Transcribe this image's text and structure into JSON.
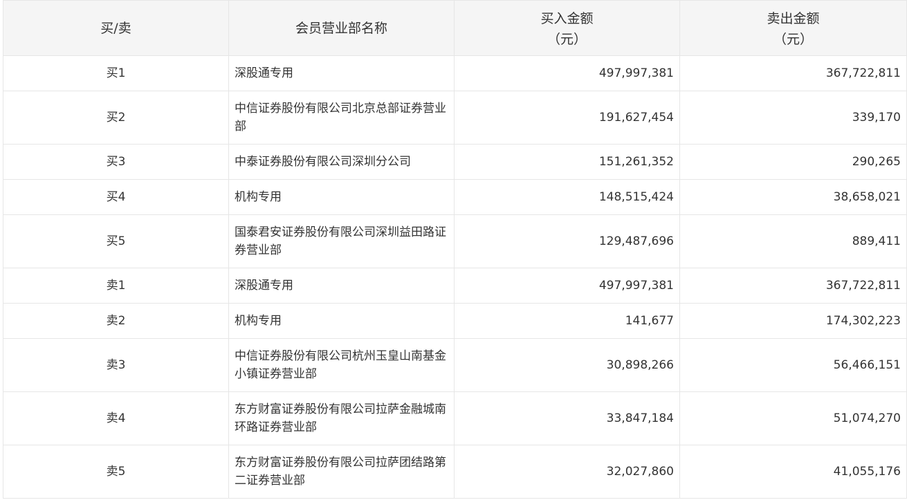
{
  "header": {
    "side": "买/卖",
    "name": "会员营业部名称",
    "buy_line1": "买入金额",
    "buy_line2": "（元）",
    "sell_line1": "卖出金额",
    "sell_line2": "（元）"
  },
  "rows": [
    {
      "side": "买1",
      "name": "深股通专用",
      "buy": "497,997,381",
      "sell": "367,722,811"
    },
    {
      "side": "买2",
      "name": "中信证券股份有限公司北京总部证券营业部",
      "buy": "191,627,454",
      "sell": "339,170"
    },
    {
      "side": "买3",
      "name": "中泰证券股份有限公司深圳分公司",
      "buy": "151,261,352",
      "sell": "290,265"
    },
    {
      "side": "买4",
      "name": "机构专用",
      "buy": "148,515,424",
      "sell": "38,658,021"
    },
    {
      "side": "买5",
      "name": "国泰君安证券股份有限公司深圳益田路证券营业部",
      "buy": "129,487,696",
      "sell": "889,411"
    },
    {
      "side": "卖1",
      "name": "深股通专用",
      "buy": "497,997,381",
      "sell": "367,722,811"
    },
    {
      "side": "卖2",
      "name": "机构专用",
      "buy": "141,677",
      "sell": "174,302,223"
    },
    {
      "side": "卖3",
      "name": "中信证券股份有限公司杭州玉皇山南基金小镇证券营业部",
      "buy": "30,898,266",
      "sell": "56,466,151"
    },
    {
      "side": "卖4",
      "name": "东方财富证券股份有限公司拉萨金融城南环路证券营业部",
      "buy": "33,847,184",
      "sell": "51,074,270"
    },
    {
      "side": "卖5",
      "name": "东方财富证券股份有限公司拉萨团结路第二证券营业部",
      "buy": "32,027,860",
      "sell": "41,055,176"
    }
  ]
}
